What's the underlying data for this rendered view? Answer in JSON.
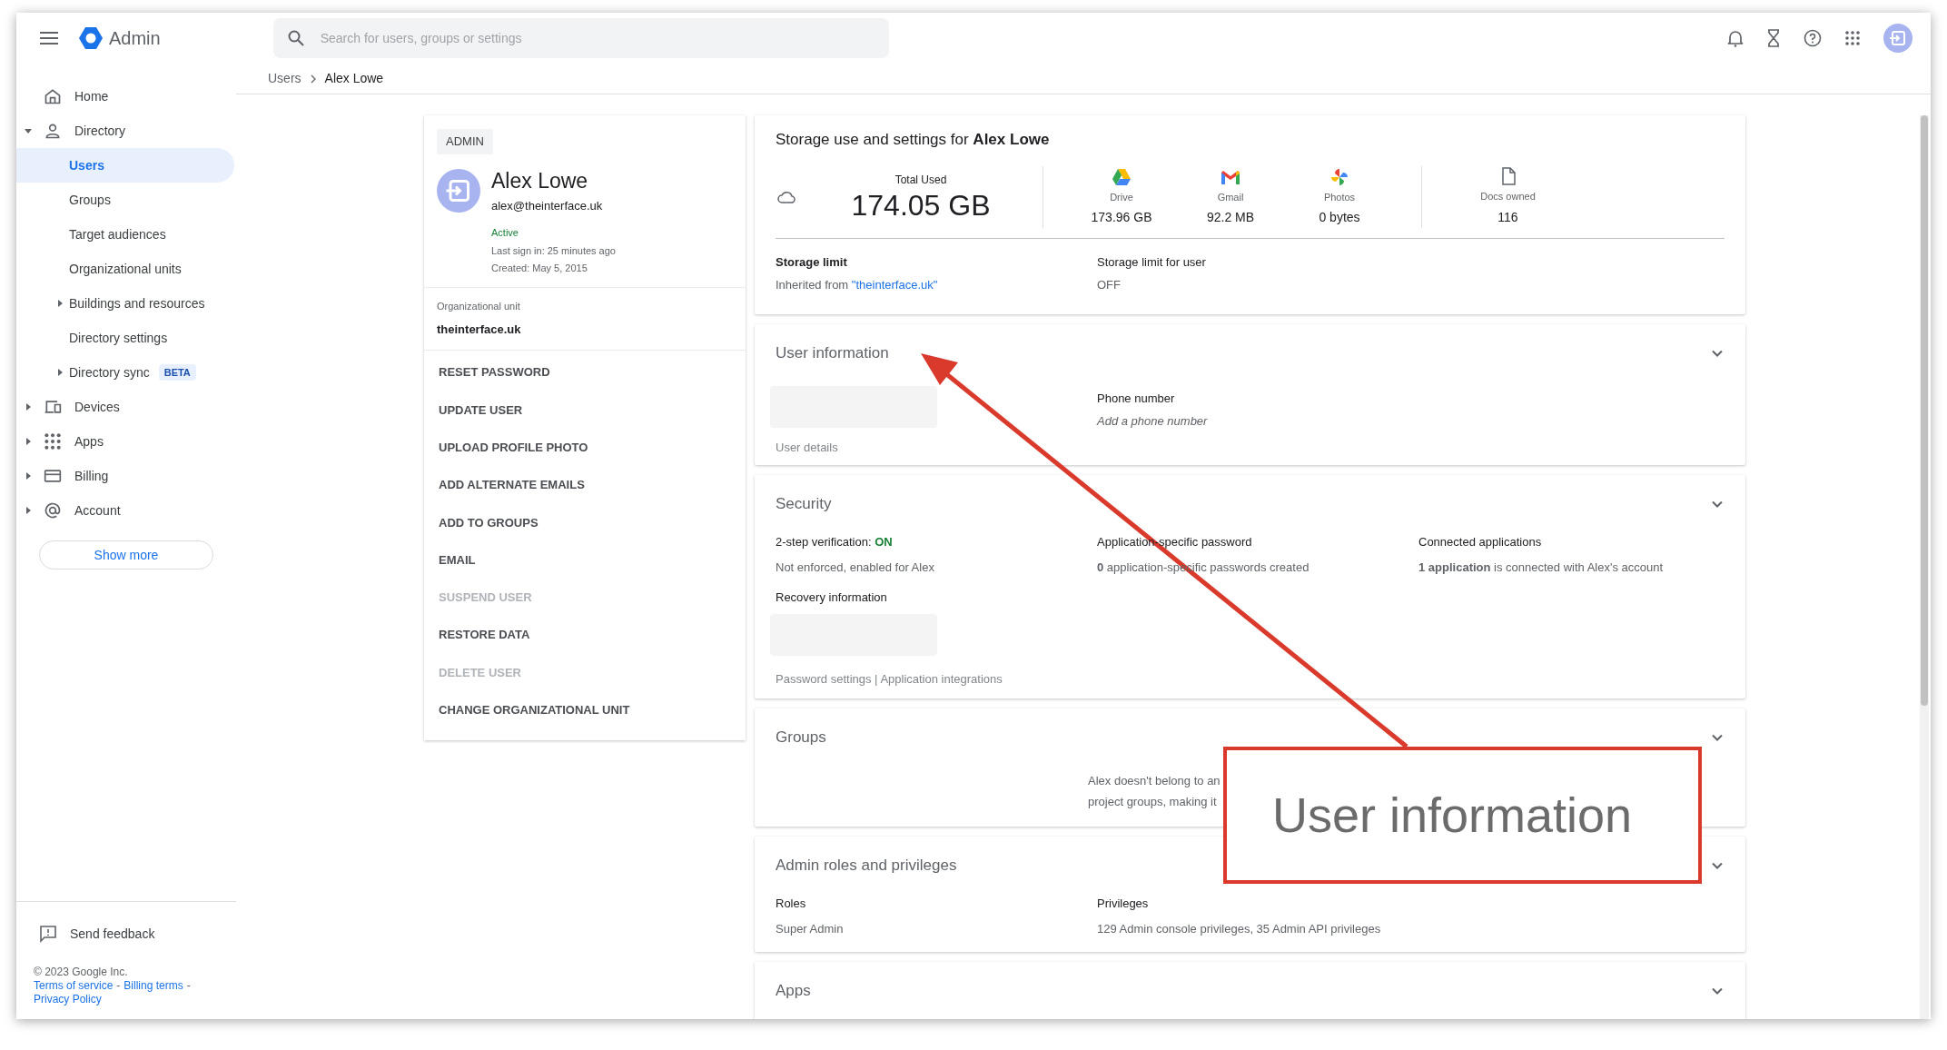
{
  "top_bar": {
    "app_name": "Admin",
    "search": {
      "placeholder": "Search for users, groups or settings"
    }
  },
  "breadcrumb": [
    {
      "label": "Users",
      "current": false
    },
    {
      "label": "Alex Lowe",
      "current": true
    }
  ],
  "sidebar": {
    "items": [
      {
        "label": "Home",
        "kind": "link",
        "selected": false
      },
      {
        "label": "Directory",
        "kind": "group",
        "expanded": true,
        "selected": false,
        "children": [
          {
            "label": "Users",
            "kind": "link",
            "selected": true
          },
          {
            "label": "Groups",
            "kind": "link",
            "selected": false
          },
          {
            "label": "Target audiences",
            "kind": "link",
            "selected": false
          },
          {
            "label": "Organizational units",
            "kind": "link",
            "selected": false
          },
          {
            "label": "Buildings and resources",
            "kind": "group",
            "expanded": false,
            "selected": false
          },
          {
            "label": "Directory settings",
            "kind": "link",
            "selected": false
          },
          {
            "label": "Directory sync",
            "kind": "group",
            "expanded": false,
            "selected": false,
            "badge": "BETA"
          }
        ]
      },
      {
        "label": "Devices",
        "kind": "group",
        "expanded": false,
        "selected": false
      },
      {
        "label": "Apps",
        "kind": "group",
        "expanded": false,
        "selected": false
      },
      {
        "label": "Billing",
        "kind": "group",
        "expanded": false,
        "selected": false
      },
      {
        "label": "Account",
        "kind": "group",
        "expanded": false,
        "selected": false
      }
    ],
    "show_more": "Show more",
    "feedback": "Send feedback",
    "copyright": "© 2023 Google Inc.",
    "separator": "-",
    "links": [
      "Terms of service",
      "Billing terms",
      "Privacy Policy"
    ]
  },
  "user_card": {
    "role_badge": "ADMIN",
    "name": "Alex Lowe",
    "email": "alex@theinterface.uk",
    "status": "Active",
    "last_sign_in": "Last sign in: 25 minutes ago",
    "created": "Created: May 5, 2015",
    "org_unit_label": "Organizational unit",
    "org_unit": "theinterface.uk",
    "actions": [
      {
        "label": "RESET PASSWORD",
        "disabled": false
      },
      {
        "label": "UPDATE USER",
        "disabled": false
      },
      {
        "label": "UPLOAD PROFILE PHOTO",
        "disabled": false
      },
      {
        "label": "ADD ALTERNATE EMAILS",
        "disabled": false
      },
      {
        "label": "ADD TO GROUPS",
        "disabled": false
      },
      {
        "label": "EMAIL",
        "disabled": false
      },
      {
        "label": "SUSPEND USER",
        "disabled": true
      },
      {
        "label": "RESTORE DATA",
        "disabled": false
      },
      {
        "label": "DELETE USER",
        "disabled": true
      },
      {
        "label": "CHANGE ORGANIZATIONAL UNIT",
        "disabled": false
      }
    ]
  },
  "storage": {
    "title": "Storage use and settings for **Alex Lowe**",
    "total_label": "Total Used",
    "total": "174.05 GB",
    "services": [
      {
        "name": "Drive",
        "value": "173.96 GB"
      },
      {
        "name": "Gmail",
        "value": "92.2 MB"
      },
      {
        "name": "Photos",
        "value": "0 bytes"
      }
    ],
    "docs_label": "Docs owned",
    "docs": "116",
    "limit_label": "Storage limit",
    "limit_prefix": "Inherited from",
    "limit_link": "\"theinterface.uk\"",
    "user_limit_label": "Storage limit for user",
    "user_limit": "OFF"
  },
  "sections": [
    {
      "kind": "user_information",
      "title": "User information",
      "details_link": "User details",
      "phone_label": "Phone number",
      "phone_hint": "Add a phone number"
    },
    {
      "kind": "security",
      "title": "Security",
      "fields": [
        {
          "label": "2-step verification:",
          "status": "ON",
          "detail": "Not enforced, enabled for Alex"
        },
        {
          "label": "Application-specific password",
          "detail": "**0** application-specific passwords created"
        },
        {
          "label": "Connected applications",
          "detail": "**1 application** is connected with Alex's account"
        }
      ],
      "recovery_label": "Recovery information",
      "links": "Password settings | Application integrations"
    },
    {
      "kind": "groups",
      "title": "Groups",
      "lines": [
        "Alex doesn't belong to an",
        "project groups, making it"
      ]
    },
    {
      "kind": "fields",
      "title": "Admin roles and privileges",
      "fields": [
        {
          "label": "Roles",
          "detail": "Super Admin"
        },
        {
          "label": "Privileges",
          "detail": "129 Admin console privileges, 35 Admin API privileges"
        }
      ]
    },
    {
      "kind": "title_only",
      "title": "Apps"
    }
  ],
  "annotation": {
    "callout_text": "User information"
  }
}
